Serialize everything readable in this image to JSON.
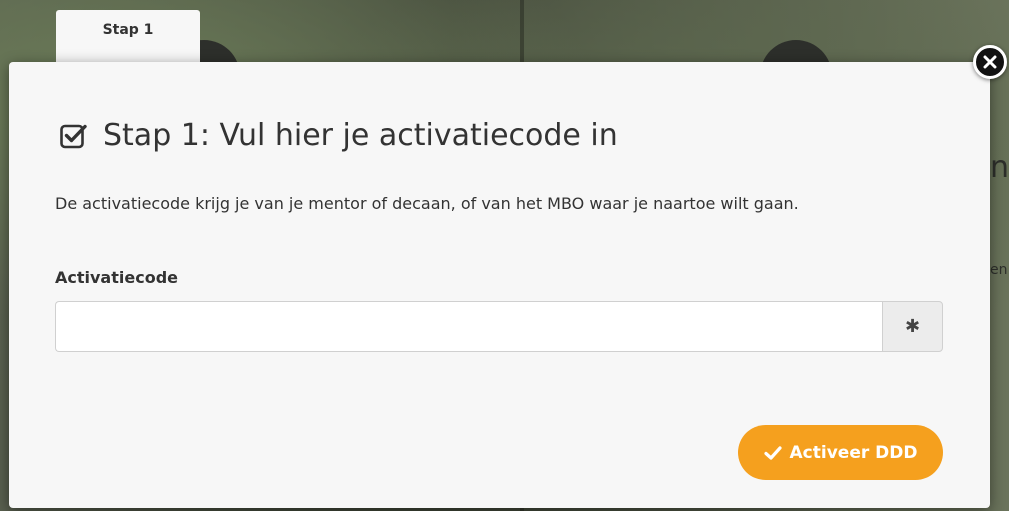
{
  "background": {
    "edge_text": "n",
    "edge_text_small": "en"
  },
  "step_tab": {
    "label": "Stap 1"
  },
  "modal": {
    "title": "Stap 1: Vul hier je activatiecode in",
    "title_icon": "checkbox-checked-icon",
    "description": "De activatiecode krijg je van je mentor of decaan, of van het MBO waar je naartoe wilt gaan.",
    "close_icon": "close-icon",
    "field": {
      "label": "Activatiecode",
      "value": "",
      "placeholder": "",
      "addon_icon": "asterisk-icon",
      "addon_glyph": "✱"
    },
    "submit": {
      "label": "Activeer DDD",
      "icon": "checkmark-icon"
    }
  },
  "colors": {
    "accent": "#f5a01e",
    "modal_background": "#f7f7f7",
    "text": "#333333"
  }
}
